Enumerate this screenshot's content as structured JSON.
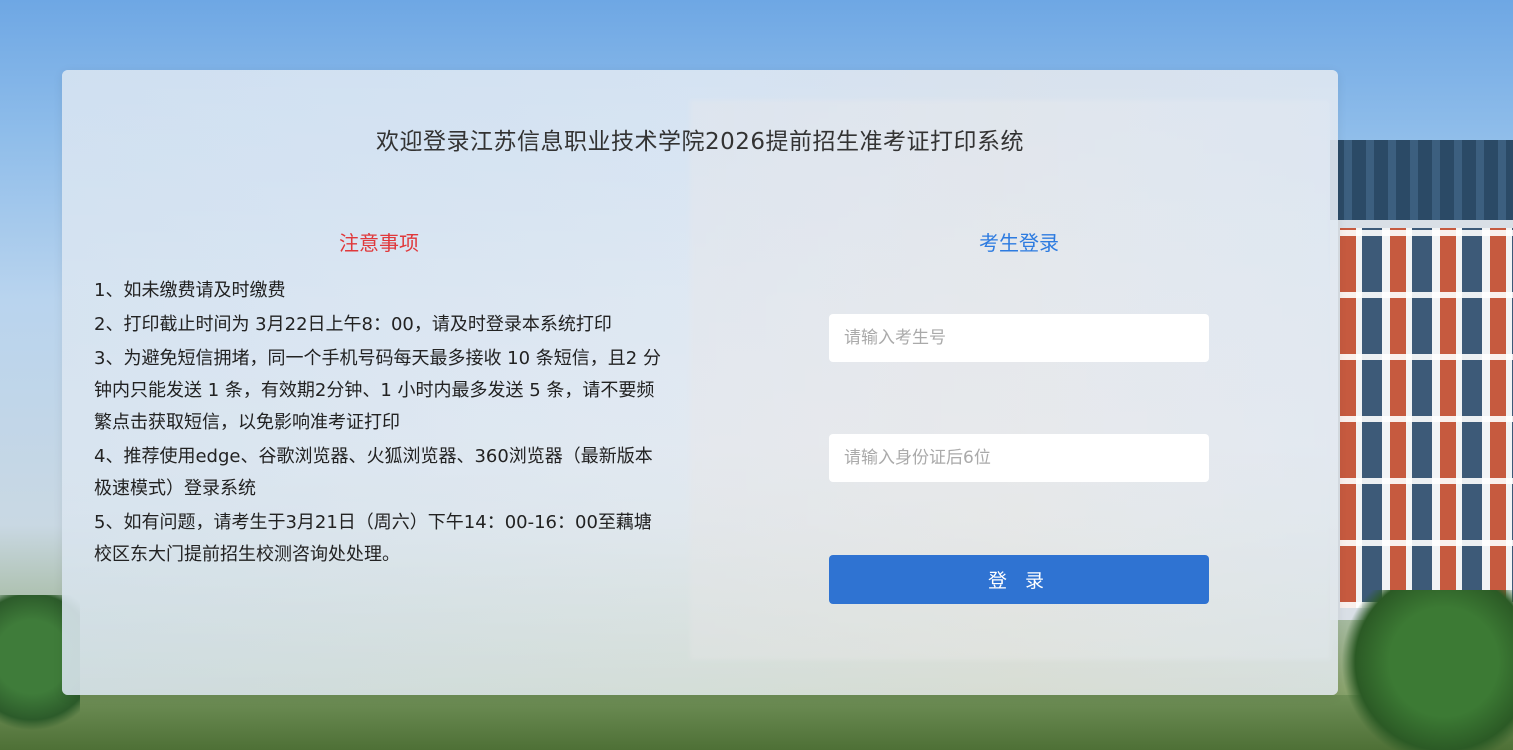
{
  "page": {
    "title": "欢迎登录江苏信息职业技术学院2026提前招生准考证打印系统"
  },
  "notice": {
    "heading": "注意事项",
    "items": [
      "1、如未缴费请及时缴费",
      "2、打印截止时间为 3月22日上午8：00，请及时登录本系统打印",
      "3、为避免短信拥堵，同一个手机号码每天最多接收 10 条短信，且2 分钟内只能发送 1 条，有效期2分钟、1 小时内最多发送 5 条，请不要频繁点击获取短信，以免影响准考证打印",
      "4、推荐使用edge、谷歌浏览器、火狐浏览器、360浏览器（最新版本极速模式）登录系统",
      "5、如有问题，请考生于3月21日（周六）下午14：00-16：00至藕塘校区东大门提前招生校测咨询处处理。"
    ]
  },
  "login": {
    "heading": "考生登录",
    "exam_no_placeholder": "请输入考生号",
    "id_card_placeholder": "请输入身份证后6位",
    "submit_label": "登 录"
  },
  "colors": {
    "notice_heading": "#e0383b",
    "login_heading": "#2d7be0",
    "button": "#2f73d2"
  }
}
